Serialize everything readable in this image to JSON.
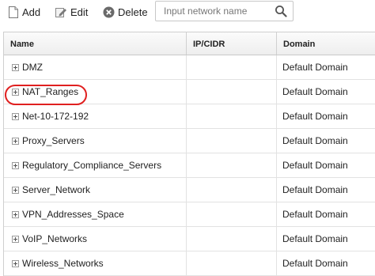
{
  "toolbar": {
    "add_label": "Add",
    "edit_label": "Edit",
    "delete_label": "Delete",
    "add_icon": "add-document-icon",
    "edit_icon": "edit-pencil-icon",
    "delete_icon": "delete-x-icon"
  },
  "search": {
    "placeholder": "Input network name",
    "value": "",
    "icon": "search-icon"
  },
  "table": {
    "columns": [
      "Name",
      "IP/CIDR",
      "Domain"
    ],
    "rows": [
      {
        "name": "DMZ",
        "ip_cidr": "",
        "domain": "Default Domain"
      },
      {
        "name": "NAT_Ranges",
        "ip_cidr": "",
        "domain": "Default Domain"
      },
      {
        "name": "Net-10-172-192",
        "ip_cidr": "",
        "domain": "Default Domain"
      },
      {
        "name": "Proxy_Servers",
        "ip_cidr": "",
        "domain": "Default Domain"
      },
      {
        "name": "Regulatory_Compliance_Servers",
        "ip_cidr": "",
        "domain": "Default Domain"
      },
      {
        "name": "Server_Network",
        "ip_cidr": "",
        "domain": "Default Domain"
      },
      {
        "name": "VPN_Addresses_Space",
        "ip_cidr": "",
        "domain": "Default Domain"
      },
      {
        "name": "VoIP_Networks",
        "ip_cidr": "",
        "domain": "Default Domain"
      },
      {
        "name": "Wireless_Networks",
        "ip_cidr": "",
        "domain": "Default Domain"
      }
    ]
  },
  "colors": {
    "highlight": "#e02020",
    "delete_icon": "#6a6a6a"
  }
}
